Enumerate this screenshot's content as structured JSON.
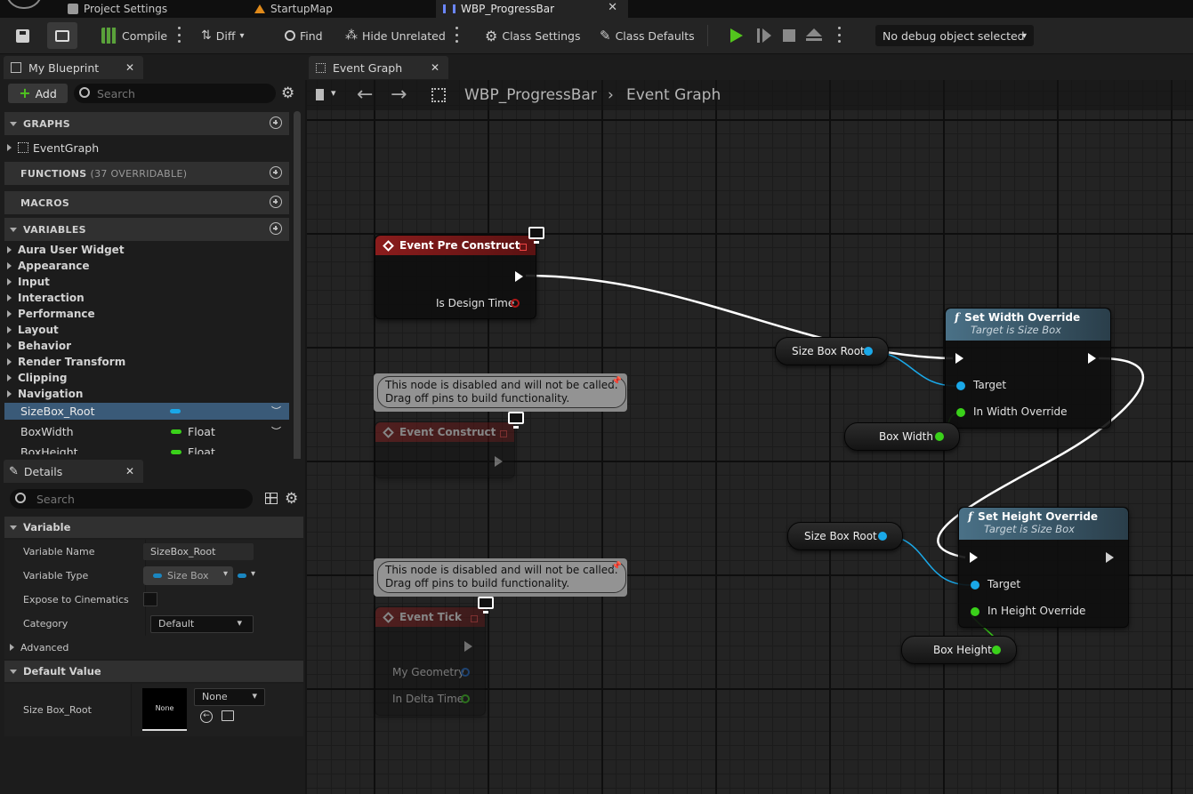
{
  "tabs": {
    "project_settings": "Project Settings",
    "startup_map": "StartupMap",
    "wbp": "WBP_ProgressBar"
  },
  "toolbar": {
    "compile": "Compile",
    "diff": "Diff",
    "find": "Find",
    "hide_unrelated": "Hide Unrelated",
    "class_settings": "Class Settings",
    "class_defaults": "Class Defaults",
    "debug_object": "No debug object selected"
  },
  "my_blueprint": {
    "tab": "My Blueprint",
    "add": "Add",
    "search_placeholder": "Search",
    "graphs": "GRAPHS",
    "event_graph": "EventGraph",
    "functions": "FUNCTIONS",
    "functions_count": "(37 OVERRIDABLE)",
    "macros": "MACROS",
    "variables": "VARIABLES",
    "categories": [
      "Aura User Widget",
      "Appearance",
      "Input",
      "Interaction",
      "Performance",
      "Layout",
      "Behavior",
      "Render Transform",
      "Clipping",
      "Navigation"
    ],
    "vars": [
      {
        "name": "SizeBox_Root",
        "type": ""
      },
      {
        "name": "BoxWidth",
        "type": "Float"
      },
      {
        "name": "BoxHeight",
        "type": "Float"
      }
    ]
  },
  "details": {
    "tab": "Details",
    "search_placeholder": "Search",
    "variable_section": "Variable",
    "rows": {
      "variable_name_label": "Variable Name",
      "variable_name_value": "SizeBox_Root",
      "variable_type_label": "Variable Type",
      "variable_type_value": "Size Box",
      "expose_label": "Expose to Cinematics",
      "category_label": "Category",
      "category_value": "Default"
    },
    "advanced": "Advanced",
    "default_value_section": "Default Value",
    "default_label": "Size Box_Root",
    "thumb_text": "None",
    "none_dropdown": "None"
  },
  "graph": {
    "tab": "Event Graph",
    "breadcrumb_bp": "WBP_ProgressBar",
    "breadcrumb_graph": "Event Graph",
    "disabled_comment_line1": "This node is disabled and will not be called.",
    "disabled_comment_line2": "Drag off pins to build functionality.",
    "nodes": {
      "pre_construct": {
        "title": "Event Pre Construct",
        "pin": "Is Design Time"
      },
      "construct": {
        "title": "Event Construct"
      },
      "tick": {
        "title": "Event Tick",
        "pin1": "My Geometry",
        "pin2": "In Delta Time"
      },
      "set_width": {
        "title": "Set Width Override",
        "subtitle": "Target is Size Box",
        "pin_target": "Target",
        "pin_value": "In Width Override"
      },
      "set_height": {
        "title": "Set Height Override",
        "subtitle": "Target is Size Box",
        "pin_target": "Target",
        "pin_value": "In Height Override"
      },
      "size_box_root_1": "Size Box Root",
      "size_box_root_2": "Size Box Root",
      "box_width": "Box Width",
      "box_height": "Box Height"
    }
  },
  "colors": {
    "exec": "#ffffff",
    "object_pin": "#1aa8e8",
    "float_pin": "#3ad11a",
    "bool_pin": "#8c0000",
    "event_header": "#7a1a1a",
    "function_header": "#3d5a6b"
  }
}
